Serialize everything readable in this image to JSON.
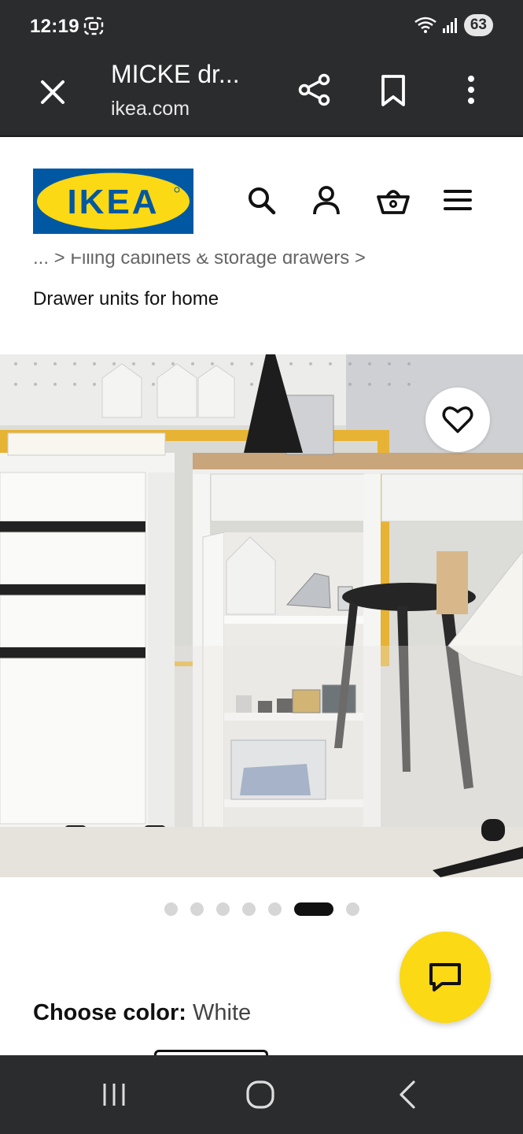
{
  "status_bar": {
    "time": "12:19",
    "battery": "63"
  },
  "browser": {
    "title": "MICKE dr...",
    "url": "ikea.com"
  },
  "header": {
    "logo_text": "IKEA"
  },
  "breadcrumb": {
    "truncated_path": "... >  Filing cabinets & storage drawers  >",
    "current": "Drawer units for home"
  },
  "gallery": {
    "dot_count": 7,
    "active_index": 5
  },
  "color_picker": {
    "label": "Choose color:",
    "value": "White"
  },
  "colors": {
    "ikea_blue": "#0058a3",
    "ikea_yellow": "#fbd914",
    "chrome_bg": "#2b2c2e"
  }
}
